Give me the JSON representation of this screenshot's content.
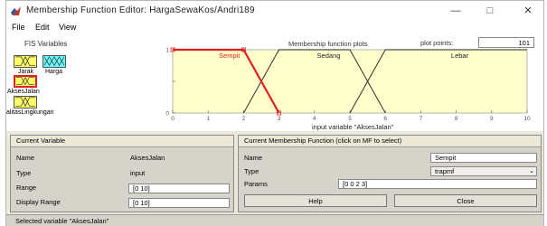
{
  "window": {
    "title": "Membership Function Editor: HargaSewaKos/Andri189",
    "controls": {
      "minimize": "—",
      "maximize": "□",
      "close": "✕"
    }
  },
  "menu": [
    "File",
    "Edit",
    "View"
  ],
  "fis": {
    "title": "FIS Variables",
    "inputs": [
      "Jarak",
      "Harga",
      "AksesJalan",
      "alitasLingkungan"
    ]
  },
  "plot": {
    "header": "Membership function plots",
    "points_label": "plot points:",
    "points_value": "101",
    "axis_title": "input variable \"AksesJalan\""
  },
  "chart_data": {
    "type": "line",
    "xlim": [
      0,
      10
    ],
    "ylim": [
      0,
      1
    ],
    "x_ticks": [
      "0",
      "1",
      "2",
      "3",
      "4",
      "5",
      "6",
      "7",
      "8",
      "9",
      "10"
    ],
    "y_ticks": [
      "0",
      "0.5",
      "1"
    ],
    "series": [
      {
        "name": "Sempit",
        "points": [
          [
            0,
            1
          ],
          [
            2,
            1
          ],
          [
            3,
            0
          ]
        ],
        "color": "#e02020"
      },
      {
        "name": "Sedang",
        "points": [
          [
            2,
            0
          ],
          [
            3,
            1
          ],
          [
            5,
            1
          ],
          [
            6,
            0
          ]
        ],
        "color": "#222222"
      },
      {
        "name": "Lebar",
        "points": [
          [
            5,
            0
          ],
          [
            6,
            1
          ],
          [
            10,
            1
          ]
        ],
        "color": "#222222"
      }
    ],
    "label_x": [
      1.6,
      4.4,
      8.1
    ]
  },
  "current_variable": {
    "header": "Current Variable",
    "name_label": "Name",
    "name_value": "AksesJalan",
    "type_label": "Type",
    "type_value": "input",
    "range_label": "Range",
    "range_value": "[0 10]",
    "display_range_label": "Display Range",
    "display_range_value": "[0 10]"
  },
  "current_mf": {
    "header": "Current Membership Function (click on MF to select)",
    "name_label": "Name",
    "name_value": "Sempit",
    "type_label": "Type",
    "type_value": "trapmf",
    "params_label": "Params",
    "params_value": "[0 0 2 3]"
  },
  "buttons": {
    "help": "Help",
    "close": "Close"
  },
  "status": "Selected variable \"AksesJalan\"",
  "colors": {
    "selected_mf": "#e02020",
    "plot_bg": "#ffffcc",
    "input_box": "#ffff66",
    "output_box": "#66ffff"
  }
}
